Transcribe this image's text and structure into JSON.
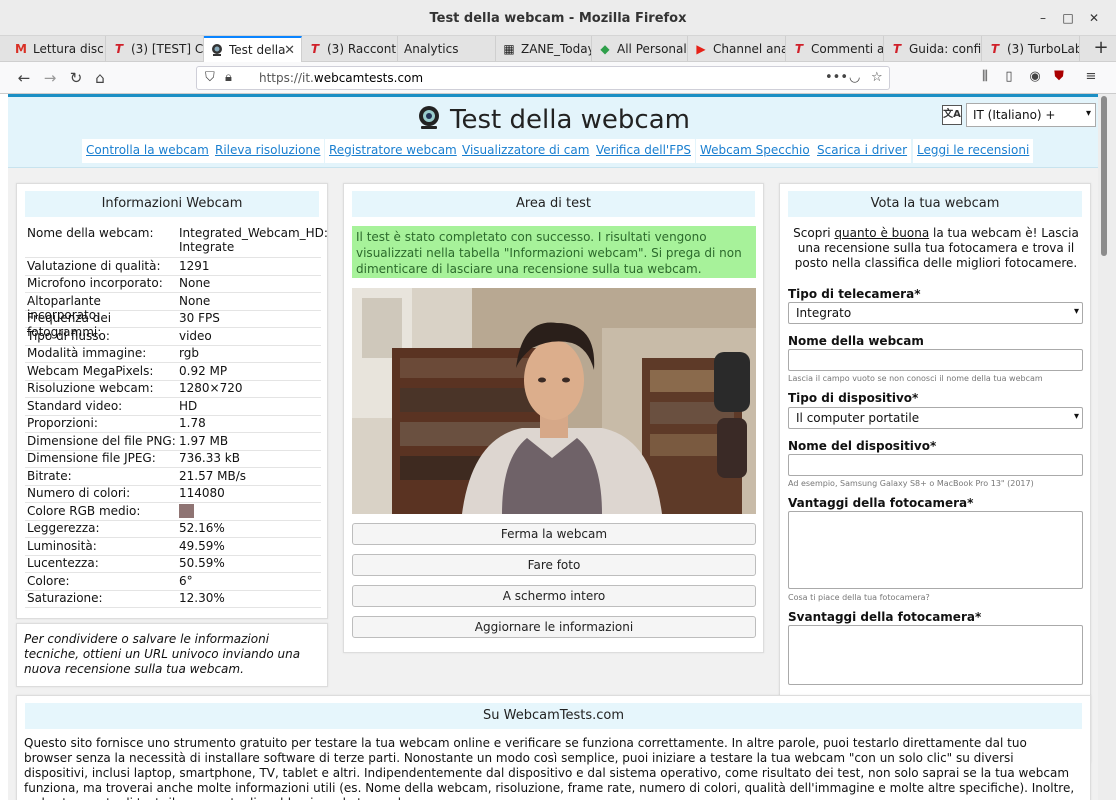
{
  "window": {
    "title": "Test della webcam - Mozilla Firefox"
  },
  "tabs": [
    {
      "label": "Lettura disc",
      "icon": "gmail-icon"
    },
    {
      "label": "(3) [TEST] Co",
      "icon": "t-icon"
    },
    {
      "label": "Test della",
      "icon": "webcam-icon",
      "active": true
    },
    {
      "label": "(3) Raccont",
      "icon": "t-icon"
    },
    {
      "label": "Analytics",
      "icon": ""
    },
    {
      "label": "ZANE_Today",
      "icon": "calendar-icon"
    },
    {
      "label": "All Personal",
      "icon": "diamond-icon"
    },
    {
      "label": "Channel ana",
      "icon": "youtube-icon"
    },
    {
      "label": "Commenti a",
      "icon": "t-icon"
    },
    {
      "label": "Guida: confi",
      "icon": "t-icon"
    },
    {
      "label": "(3) TurboLab",
      "icon": "t-icon"
    }
  ],
  "navbar": {
    "url_prefix": "https://it.",
    "url_domain": "webcamtests.com"
  },
  "header": {
    "site_title": "Test della webcam",
    "language": "IT (Italiano) +",
    "links": [
      "Controlla la webcam",
      "Rileva risoluzione",
      "Registratore webcam",
      "Visualizzatore di cam",
      "Verifica dell'FPS",
      "Webcam Specchio",
      "Scarica i driver",
      "Leggi le recensioni"
    ]
  },
  "info": {
    "title": "Informazioni Webcam",
    "rows": [
      {
        "k": "Nome della webcam:",
        "v": "Integrated_Webcam_HD: Integrate"
      },
      {
        "k": "Valutazione di qualità:",
        "v": "1291"
      },
      {
        "k": "Microfono incorporato:",
        "v": "None"
      },
      {
        "k": "Altoparlante incorporato:",
        "v": "None"
      },
      {
        "k": "Frequenza dei fotogrammi:",
        "v": "30 FPS"
      },
      {
        "k": "Tipo di flusso:",
        "v": "video"
      },
      {
        "k": "Modalità immagine:",
        "v": "rgb"
      },
      {
        "k": "Webcam MegaPixels:",
        "v": "0.92 MP"
      },
      {
        "k": "Risoluzione webcam:",
        "v": "1280×720"
      },
      {
        "k": "Standard video:",
        "v": "HD"
      },
      {
        "k": "Proporzioni:",
        "v": "1.78"
      },
      {
        "k": "Dimensione del file PNG:",
        "v": "1.97 MB"
      },
      {
        "k": "Dimensione file JPEG:",
        "v": "736.33 kB"
      },
      {
        "k": "Bitrate:",
        "v": "21.57 MB/s"
      },
      {
        "k": "Numero di colori:",
        "v": "114080"
      },
      {
        "k": "Colore RGB medio:",
        "v": ""
      },
      {
        "k": "Leggerezza:",
        "v": "52.16%"
      },
      {
        "k": "Luminosità:",
        "v": "49.59%"
      },
      {
        "k": "Lucentezza:",
        "v": "50.59%"
      },
      {
        "k": "Colore:",
        "v": "6°"
      },
      {
        "k": "Saturazione:",
        "v": "12.30%"
      }
    ],
    "avg_color": "#8f7473",
    "share_text": "Per condividere o salvare le informazioni tecniche, ottieni un URL univoco inviando una nuova recensione sulla tua webcam."
  },
  "test": {
    "title": "Area di test",
    "success": "Il test è stato completato con successo. I risultati vengono visualizzati nella tabella \"Informazioni webcam\". Si prega di non dimenticare di lasciare una recensione sulla tua webcam.",
    "buttons": [
      "Ferma la webcam",
      "Fare foto",
      "A schermo intero",
      "Aggiornare le informazioni"
    ]
  },
  "vote": {
    "title": "Vota la tua webcam",
    "intro_pre": "Scopri ",
    "intro_link": "quanto è buona",
    "intro_post": " la tua webcam è! Lascia una recensione sulla tua fotocamera e trova il posto nella classifica delle migliori fotocamere.",
    "camera_type_label": "Tipo di telecamera*",
    "camera_type_value": "Integrato",
    "webcam_name_label": "Nome della webcam",
    "webcam_name_hint": "Lascia il campo vuoto se non conosci il nome della tua webcam",
    "device_type_label": "Tipo di dispositivo*",
    "device_type_value": "Il computer portatile",
    "device_name_label": "Nome del dispositivo*",
    "device_name_hint": "Ad esempio, Samsung Galaxy S8+ o MacBook Pro 13\" (2017)",
    "pros_label": "Vantaggi della fotocamera*",
    "pros_hint": "Cosa ti piace della tua fotocamera?",
    "cons_label": "Svantaggi della fotocamera*"
  },
  "about": {
    "title": "Su WebcamTests.com",
    "text": "Questo sito fornisce uno strumento gratuito per testare la tua webcam online e verificare se funziona correttamente. In altre parole, puoi testarlo direttamente dal tuo browser senza la necessità di installare software di terze parti. Nonostante un modo così semplice, puoi iniziare a testare la tua webcam \"con un solo clic\" su diversi dispositivi, inclusi laptop, smartphone, TV, tablet e altri. Indipendentemente dal dispositivo e dal sistema operativo, come risultato dei test, non solo saprai se la tua webcam funziona, ma troverai anche molte informazioni utili (es. Nome della webcam, risoluzione, frame rate, numero di colori, qualità dell'immagine e molte altre specifiche). Inoltre, se lo strumento di test rileva eventuali problemi con la tua webcam,"
  }
}
